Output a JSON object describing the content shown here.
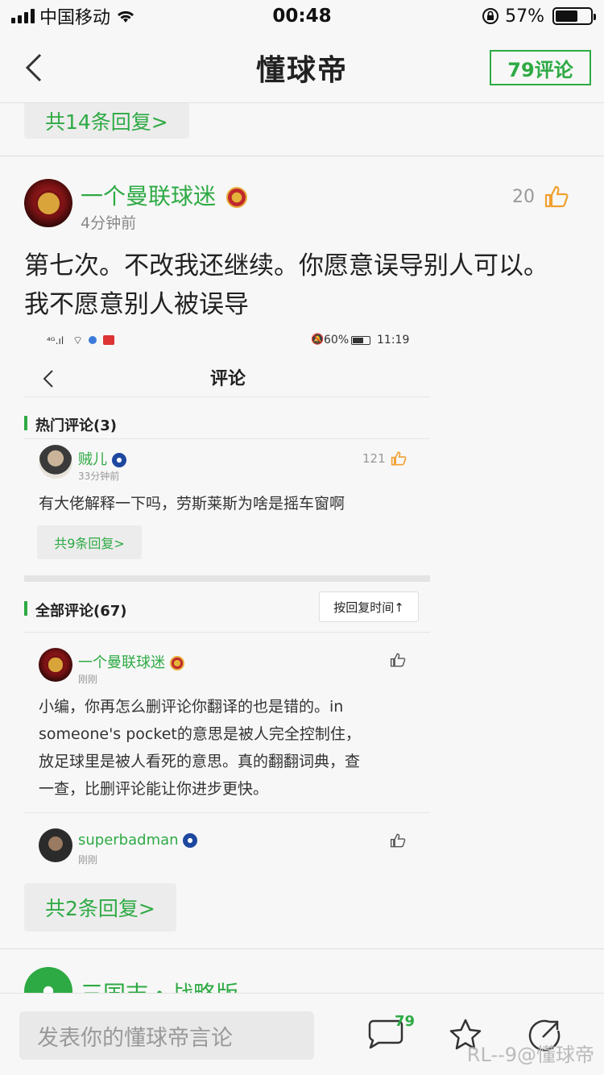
{
  "status_bar": {
    "carrier": "中国移动",
    "time": "00:48",
    "battery": "57%"
  },
  "nav": {
    "title": "懂球帝",
    "comment_count_label": "79评论"
  },
  "prev_comment": {
    "reply_count_label": "共14条回复>"
  },
  "comment": {
    "username": "一个曼联球迷",
    "timestamp": "4分钟前",
    "likes": "20",
    "text_line1": "第七次。不改我还继续。你愿意误导别人可以。",
    "text_line2": "我不愿意别人被误导",
    "reply_count_label": "共2条回复>"
  },
  "embedded": {
    "status_left": "⁴ᴳ.ıl",
    "status_right_battery": "60%",
    "status_right_time": "11:19",
    "title": "评论",
    "hot_section_label": "热门评论(3)",
    "hot_comment": {
      "username": "贼儿",
      "timestamp": "33分钟前",
      "likes": "121",
      "text": "有大佬解释一下吗，劳斯莱斯为啥是摇车窗啊",
      "reply_label": "共9条回复>"
    },
    "all_section_label": "全部评论(67)",
    "sort_label": "按回复时间↑",
    "comment1": {
      "username": "一个曼联球迷",
      "timestamp": "刚刚",
      "line1": "小编，你再怎么删评论你翻译的也是错的。in",
      "line2": "someone's pocket的意思是被人完全控制住，",
      "line3": "放足球里是被人看死的意思。真的翻翻词典，查",
      "line4": "一查，比删评论能让你进步更快。"
    },
    "comment2": {
      "username": "superbadman",
      "timestamp": "刚刚"
    }
  },
  "next_comment": {
    "username_partial": "三国志・战略版"
  },
  "bottom_bar": {
    "input_placeholder": "发表你的懂球帝言论",
    "comment_badge": "79"
  },
  "watermark": "RL--9@懂球帝",
  "colors": {
    "accent": "#2eaa44",
    "like": "#f0a030"
  }
}
